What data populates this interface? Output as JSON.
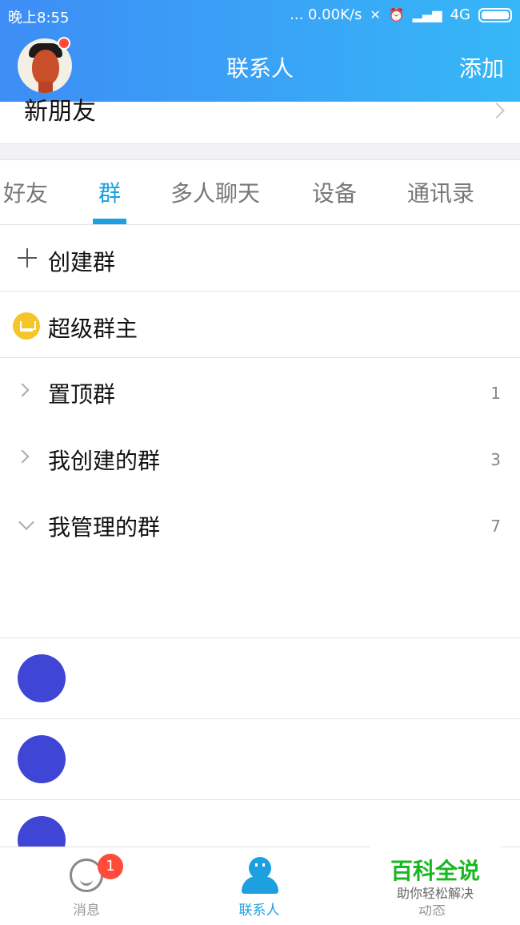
{
  "status_bar": {
    "time": "晚上8:55",
    "speed": "... 0.00K/s",
    "network": "4G"
  },
  "header": {
    "title": "联系人",
    "add_label": "添加"
  },
  "new_friends": {
    "label": "新朋友"
  },
  "tabs": [
    {
      "label": "好友"
    },
    {
      "label": "群"
    },
    {
      "label": "多人聊天"
    },
    {
      "label": "设备"
    },
    {
      "label": "通讯录"
    }
  ],
  "actions": {
    "create_group": "创建群",
    "super_group_owner": "超级群主"
  },
  "sections": [
    {
      "label": "置顶群",
      "count": "1"
    },
    {
      "label": "我创建的群",
      "count": "3"
    },
    {
      "label": "我管理的群",
      "count": "7"
    }
  ],
  "bottom_nav": {
    "messages": "消息",
    "messages_badge": "1",
    "contacts": "联系人",
    "feed": "动态"
  },
  "brand": {
    "title": "百科全说",
    "subtitle": "助你轻松解决"
  },
  "colors": {
    "header_gradient_start": "#3d8df5",
    "header_gradient_end": "#36b7f7",
    "accent": "#1ca0e0",
    "badge": "#ff4b3a",
    "brand_green": "#18b820"
  }
}
